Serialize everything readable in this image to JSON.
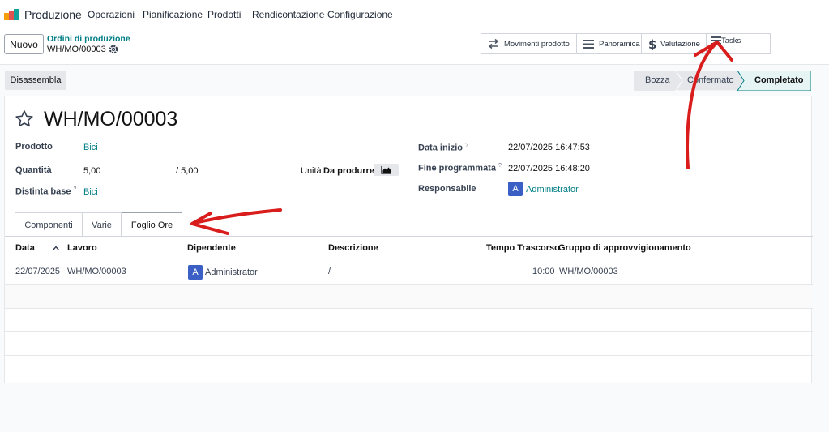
{
  "nav": {
    "app_name": "Produzione",
    "menu": [
      "Operazioni",
      "Pianificazione",
      "Prodotti",
      "Rendicontazione",
      "Configurazione"
    ]
  },
  "control": {
    "new_label": "Nuovo",
    "breadcrumb_parent": "Ordini di produzione",
    "breadcrumb_current": "WH/MO/00003"
  },
  "smart_buttons": {
    "movements": "Movimenti prodotto",
    "overview": "Panoramica",
    "valuation": "Valutazione",
    "tasks": "Tasks"
  },
  "actions": {
    "disassemble": "Disassembla"
  },
  "status": {
    "steps": [
      "Bozza",
      "Confermato",
      "Completato"
    ],
    "current": "Completato"
  },
  "record": {
    "title": "WH/MO/00003",
    "product_label": "Prodotto",
    "product_value": "Bici",
    "quantity_label": "Quantità",
    "quantity_value": "5,00",
    "quantity_total": "/ 5,00",
    "unit_label": "Unità",
    "unit_value": "Da produrre",
    "bom_label": "Distinta base",
    "bom_help": "?",
    "bom_value": "Bici",
    "start_label": "Data inizio",
    "start_help": "?",
    "start_value": "22/07/2025 16:47:53",
    "end_label": "Fine programmata",
    "end_help": "?",
    "end_value": "22/07/2025 16:48:20",
    "responsible_label": "Responsabile",
    "responsible_avatar": "A",
    "responsible_value": "Administrator"
  },
  "tabs": [
    "Componenti",
    "Varie",
    "Foglio Ore"
  ],
  "timesheet": {
    "columns": [
      "Data",
      "Lavoro",
      "Dipendente",
      "Descrizione",
      "Tempo Trascorso",
      "Gruppo di approvvigionamento"
    ],
    "rows": [
      {
        "date": "22/07/2025",
        "work": "WH/MO/00003",
        "employee_avatar": "A",
        "employee": "Administrator",
        "description": "/",
        "time": "10:00",
        "group": "WH/MO/00003"
      }
    ]
  },
  "colors": {
    "accent": "#017e84",
    "avatar": "#3b5fc4",
    "annotation": "#d91c1c"
  }
}
